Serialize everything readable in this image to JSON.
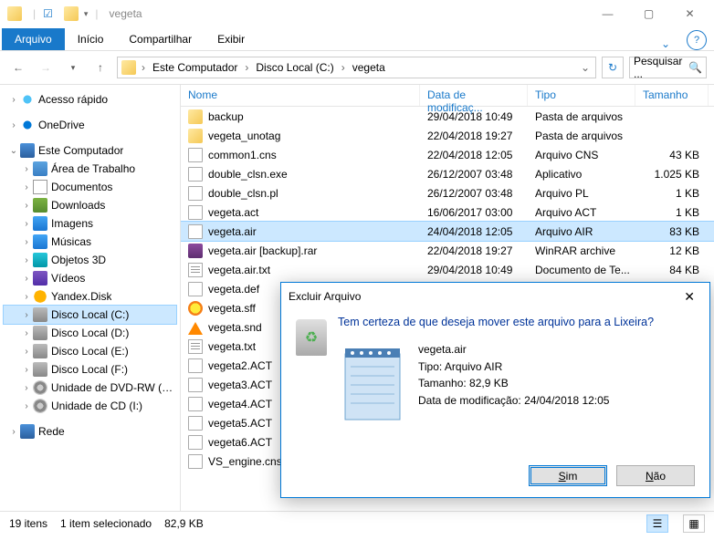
{
  "window": {
    "title": "vegeta"
  },
  "ribbon": {
    "file": "Arquivo",
    "tabs": [
      "Início",
      "Compartilhar",
      "Exibir"
    ]
  },
  "breadcrumb": [
    "Este Computador",
    "Disco Local (C:)",
    "vegeta"
  ],
  "search": {
    "placeholder": "Pesquisar ..."
  },
  "tree": {
    "quick": "Acesso rápido",
    "onedrive": "OneDrive",
    "pc": "Este Computador",
    "desktop": "Área de Trabalho",
    "documents": "Documentos",
    "downloads": "Downloads",
    "images": "Imagens",
    "music": "Músicas",
    "objects3d": "Objetos 3D",
    "videos": "Vídeos",
    "yandex": "Yandex.Disk",
    "diskC": "Disco Local (C:)",
    "diskD": "Disco Local (D:)",
    "diskE": "Disco Local (E:)",
    "diskF": "Disco Local (F:)",
    "dvd": "Unidade de DVD-RW (G:)",
    "cd": "Unidade de CD (I:)",
    "network": "Rede"
  },
  "columns": {
    "name": "Nome",
    "date": "Data de modificaç...",
    "type": "Tipo",
    "size": "Tamanho"
  },
  "files": [
    {
      "icon": "i-folder",
      "name": "backup",
      "date": "29/04/2018 10:49",
      "type": "Pasta de arquivos",
      "size": ""
    },
    {
      "icon": "i-folder",
      "name": "vegeta_unotag",
      "date": "22/04/2018 19:27",
      "type": "Pasta de arquivos",
      "size": ""
    },
    {
      "icon": "i-file",
      "name": "common1.cns",
      "date": "22/04/2018 12:05",
      "type": "Arquivo CNS",
      "size": "43 KB"
    },
    {
      "icon": "i-file",
      "name": "double_clsn.exe",
      "date": "26/12/2007 03:48",
      "type": "Aplicativo",
      "size": "1.025 KB"
    },
    {
      "icon": "i-file",
      "name": "double_clsn.pl",
      "date": "26/12/2007 03:48",
      "type": "Arquivo PL",
      "size": "1 KB"
    },
    {
      "icon": "i-file",
      "name": "vegeta.act",
      "date": "16/06/2017 03:00",
      "type": "Arquivo ACT",
      "size": "1 KB"
    },
    {
      "icon": "i-file",
      "name": "vegeta.air",
      "date": "24/04/2018 12:05",
      "type": "Arquivo AIR",
      "size": "83 KB",
      "selected": true
    },
    {
      "icon": "i-rar",
      "name": "vegeta.air [backup].rar",
      "date": "22/04/2018 19:27",
      "type": "WinRAR archive",
      "size": "12 KB"
    },
    {
      "icon": "i-txt",
      "name": "vegeta.air.txt",
      "date": "29/04/2018 10:49",
      "type": "Documento de Te...",
      "size": "84 KB"
    },
    {
      "icon": "i-file",
      "name": "vegeta.def",
      "date": "",
      "type": "",
      "size": ""
    },
    {
      "icon": "i-sff",
      "name": "vegeta.sff",
      "date": "",
      "type": "",
      "size": ""
    },
    {
      "icon": "i-vlc",
      "name": "vegeta.snd",
      "date": "",
      "type": "",
      "size": ""
    },
    {
      "icon": "i-txt",
      "name": "vegeta.txt",
      "date": "",
      "type": "",
      "size": ""
    },
    {
      "icon": "i-file",
      "name": "vegeta2.ACT",
      "date": "",
      "type": "",
      "size": ""
    },
    {
      "icon": "i-file",
      "name": "vegeta3.ACT",
      "date": "",
      "type": "",
      "size": ""
    },
    {
      "icon": "i-file",
      "name": "vegeta4.ACT",
      "date": "",
      "type": "",
      "size": ""
    },
    {
      "icon": "i-file",
      "name": "vegeta5.ACT",
      "date": "",
      "type": "",
      "size": ""
    },
    {
      "icon": "i-file",
      "name": "vegeta6.ACT",
      "date": "",
      "type": "",
      "size": ""
    },
    {
      "icon": "i-file",
      "name": "VS_engine.cns",
      "date": "",
      "type": "",
      "size": ""
    }
  ],
  "status": {
    "items": "19 itens",
    "selected": "1 item selecionado",
    "size": "82,9 KB"
  },
  "dialog": {
    "title": "Excluir Arquivo",
    "question": "Tem certeza de que deseja mover este arquivo para a Lixeira?",
    "file_name": "vegeta.air",
    "file_type": "Tipo: Arquivo AIR",
    "file_size": "Tamanho: 82,9 KB",
    "file_date": "Data de modificação: 24/04/2018 12:05",
    "yes": "Sim",
    "no": "Não"
  }
}
